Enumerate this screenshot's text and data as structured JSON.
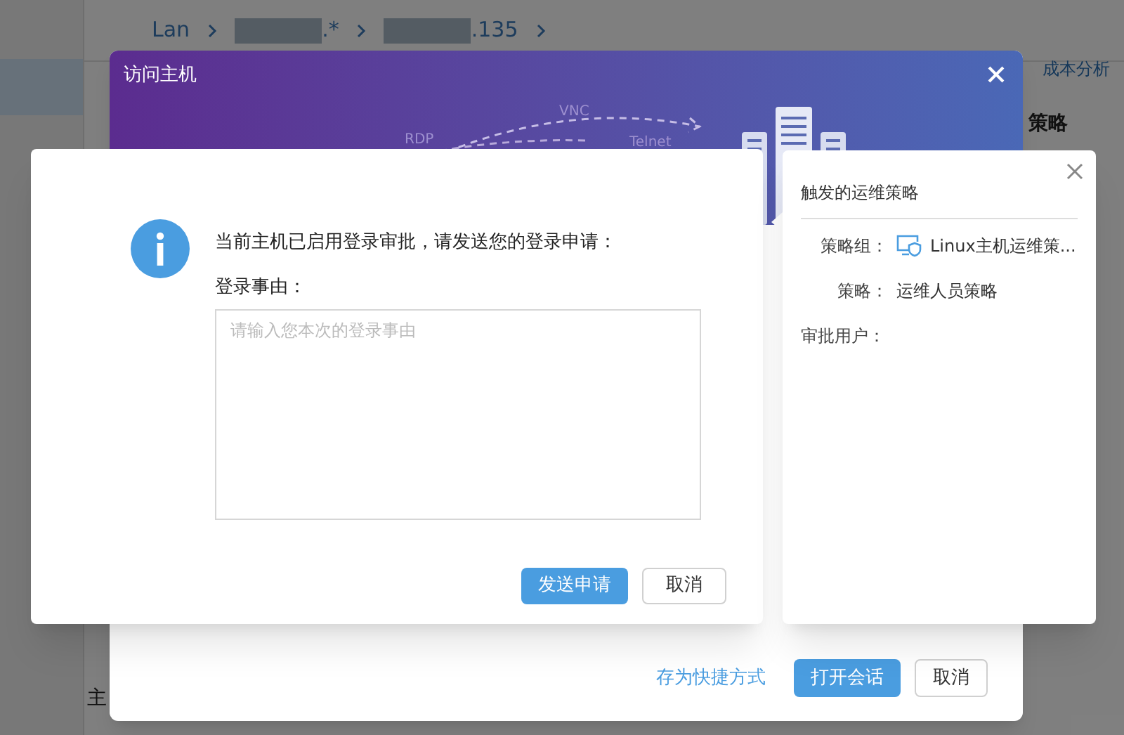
{
  "breadcrumb": [
    {
      "text": "Lan",
      "redacted": false
    },
    {
      "text": ".*",
      "redacted": true
    },
    {
      "text": ".135",
      "redacted": true
    }
  ],
  "background_fragments": [
    {
      "text": "成本分析",
      "kind": "link"
    },
    {
      "text": "策略",
      "kind": "heading"
    },
    {
      "text": "主",
      "kind": "label"
    }
  ],
  "host_dialog": {
    "title": "访问主机",
    "diagram_labels": [
      "RDP",
      "VNC",
      "Telnet"
    ],
    "shortcut_link": "存为快捷方式",
    "buttons": [
      {
        "label": "打开会话",
        "primary": true
      },
      {
        "label": "取消",
        "primary": false
      }
    ]
  },
  "approval_dialog": {
    "message": "当前主机已启用登录审批，请发送您的登录申请：",
    "field_label": "登录事由：",
    "placeholder": "请输入您本次的登录事由",
    "buttons": [
      {
        "label": "发送申请",
        "primary": true
      },
      {
        "label": "取消",
        "primary": false
      }
    ]
  },
  "policy_popover": {
    "title": "触发的运维策略",
    "rows": [
      {
        "label": "策略组：",
        "value": "Linux主机运维策...",
        "kind": "group"
      },
      {
        "label": "策略：",
        "value": "运维人员策略",
        "kind": "plain"
      },
      {
        "label": "审批用户：",
        "value": null,
        "kind": "plain"
      }
    ]
  }
}
